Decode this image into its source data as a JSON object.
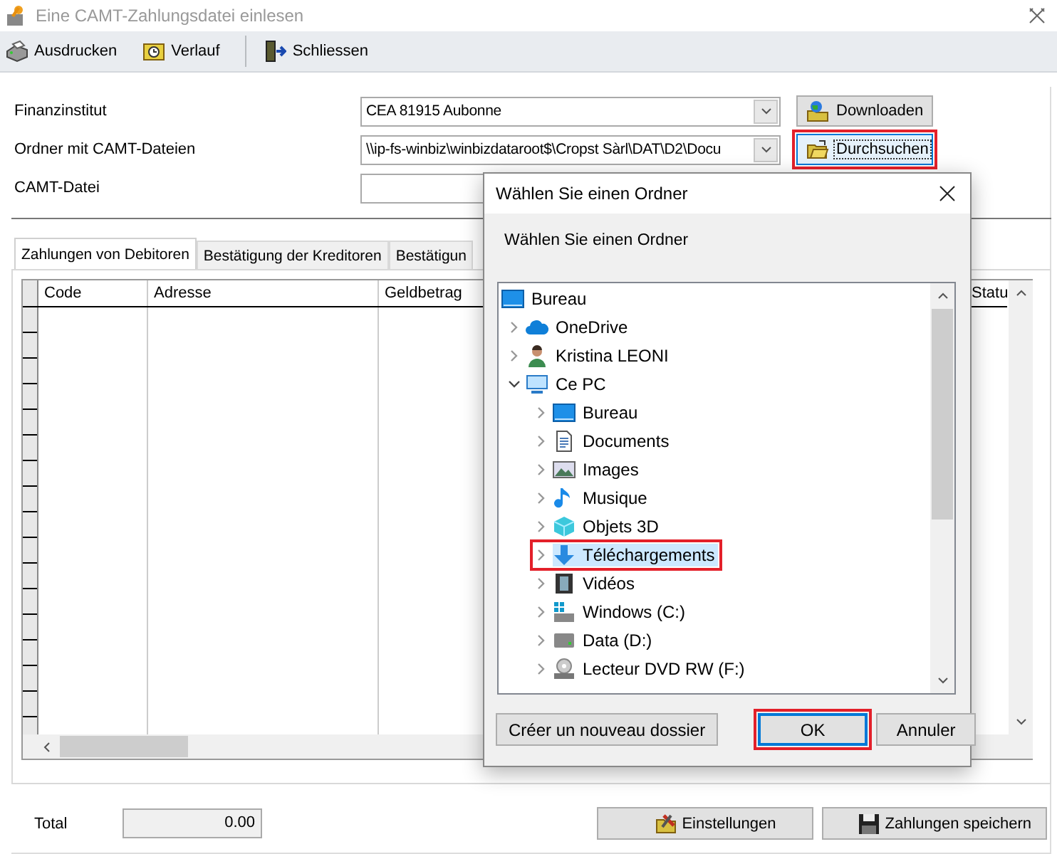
{
  "window": {
    "title": "Eine CAMT-Zahlungsdatei einlesen"
  },
  "toolbar": [
    {
      "label": "Ausdrucken",
      "kind": "printer"
    },
    {
      "label": "Verlauf",
      "kind": "history"
    },
    {
      "label": "Schliessen",
      "kind": "exit"
    }
  ],
  "form": [
    {
      "label": "Finanzinstitut",
      "kind": "combo",
      "value": "CEA 81915 Aubonne",
      "button": {
        "label": "Downloaden",
        "kind": "download",
        "focused": false,
        "highlighted": false
      }
    },
    {
      "label": "Ordner mit CAMT-Dateien",
      "kind": "combo",
      "value": "\\\\ip-fs-winbiz\\winbizdataroot$\\Cropst Sàrl\\DAT\\D2\\Docu",
      "button": {
        "label": "Durchsuchen",
        "kind": "browse",
        "focused": true,
        "highlighted": true
      }
    },
    {
      "label": "CAMT-Datei",
      "kind": "text"
    }
  ],
  "tabs": [
    {
      "label": "Zahlungen von Debitoren",
      "selected": true
    },
    {
      "label": "Bestätigung der Kreditoren",
      "selected": false
    },
    {
      "label": "Bestätigun",
      "selected": false
    }
  ],
  "table": {
    "columns": [
      "Code",
      "Adresse",
      "Geldbetrag",
      "Statu"
    ]
  },
  "footer": {
    "total_label": "Total",
    "total_value": "0.00",
    "buttons": [
      {
        "label": "Einstellungen",
        "kind": "settings"
      },
      {
        "label": "Zahlungen speichern",
        "kind": "save"
      }
    ]
  },
  "dialog": {
    "title": "Wählen Sie einen Ordner",
    "prompt": "Wählen Sie einen Ordner",
    "tree": {
      "label": "Bureau",
      "kind": "desktop",
      "children": [
        {
          "label": "OneDrive",
          "kind": "cloud",
          "expanded": false,
          "selected": false,
          "highlighted": false
        },
        {
          "label": "Kristina LEONI",
          "kind": "user",
          "expanded": false,
          "selected": false,
          "highlighted": false
        },
        {
          "label": "Ce PC",
          "kind": "pc",
          "expanded": true,
          "selected": false,
          "highlighted": false,
          "children": [
            {
              "label": "Bureau",
              "kind": "desktop",
              "expanded": false,
              "selected": false,
              "highlighted": false
            },
            {
              "label": "Documents",
              "kind": "document",
              "expanded": false,
              "selected": false,
              "highlighted": false
            },
            {
              "label": "Images",
              "kind": "image",
              "expanded": false,
              "selected": false,
              "highlighted": false
            },
            {
              "label": "Musique",
              "kind": "music",
              "expanded": false,
              "selected": false,
              "highlighted": false
            },
            {
              "label": "Objets 3D",
              "kind": "cube",
              "expanded": false,
              "selected": false,
              "highlighted": false
            },
            {
              "label": "Téléchargements",
              "kind": "download",
              "expanded": false,
              "selected": true,
              "highlighted": true
            },
            {
              "label": "Vidéos",
              "kind": "video",
              "expanded": false,
              "selected": false,
              "highlighted": false
            },
            {
              "label": "Windows (C:)",
              "kind": "windrive",
              "expanded": false,
              "selected": false,
              "highlighted": false
            },
            {
              "label": "Data (D:)",
              "kind": "drive",
              "expanded": false,
              "selected": false,
              "highlighted": false
            },
            {
              "label": "Lecteur DVD RW (F:)",
              "kind": "dvd",
              "expanded": false,
              "selected": false,
              "highlighted": false
            }
          ]
        }
      ]
    },
    "buttons": [
      {
        "label": "Créer un nouveau dossier",
        "focused": false,
        "highlighted": false
      },
      {
        "label": "OK",
        "focused": true,
        "highlighted": true
      },
      {
        "label": "Annuler",
        "focused": false,
        "highlighted": false
      }
    ]
  }
}
